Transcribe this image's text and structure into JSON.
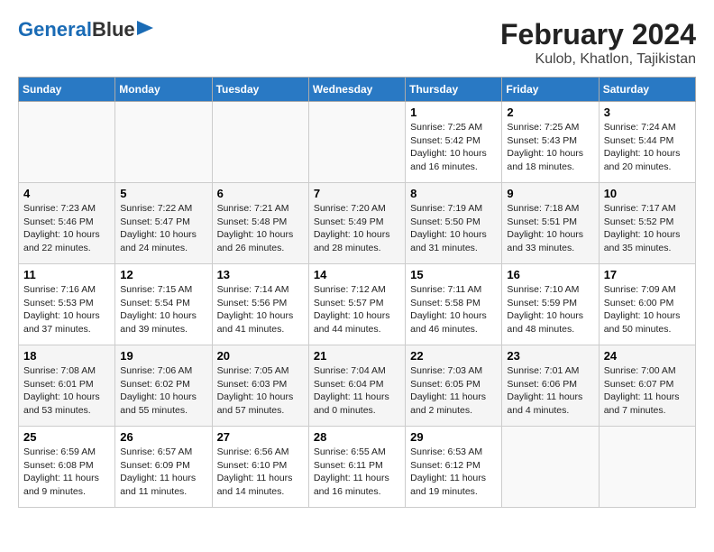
{
  "header": {
    "logo_line1": "General",
    "logo_line2": "Blue",
    "title": "February 2024",
    "subtitle": "Kulob, Khatlon, Tajikistan"
  },
  "weekdays": [
    "Sunday",
    "Monday",
    "Tuesday",
    "Wednesday",
    "Thursday",
    "Friday",
    "Saturday"
  ],
  "weeks": [
    [
      {
        "day": "",
        "detail": ""
      },
      {
        "day": "",
        "detail": ""
      },
      {
        "day": "",
        "detail": ""
      },
      {
        "day": "",
        "detail": ""
      },
      {
        "day": "1",
        "detail": "Sunrise: 7:25 AM\nSunset: 5:42 PM\nDaylight: 10 hours\nand 16 minutes."
      },
      {
        "day": "2",
        "detail": "Sunrise: 7:25 AM\nSunset: 5:43 PM\nDaylight: 10 hours\nand 18 minutes."
      },
      {
        "day": "3",
        "detail": "Sunrise: 7:24 AM\nSunset: 5:44 PM\nDaylight: 10 hours\nand 20 minutes."
      }
    ],
    [
      {
        "day": "4",
        "detail": "Sunrise: 7:23 AM\nSunset: 5:46 PM\nDaylight: 10 hours\nand 22 minutes."
      },
      {
        "day": "5",
        "detail": "Sunrise: 7:22 AM\nSunset: 5:47 PM\nDaylight: 10 hours\nand 24 minutes."
      },
      {
        "day": "6",
        "detail": "Sunrise: 7:21 AM\nSunset: 5:48 PM\nDaylight: 10 hours\nand 26 minutes."
      },
      {
        "day": "7",
        "detail": "Sunrise: 7:20 AM\nSunset: 5:49 PM\nDaylight: 10 hours\nand 28 minutes."
      },
      {
        "day": "8",
        "detail": "Sunrise: 7:19 AM\nSunset: 5:50 PM\nDaylight: 10 hours\nand 31 minutes."
      },
      {
        "day": "9",
        "detail": "Sunrise: 7:18 AM\nSunset: 5:51 PM\nDaylight: 10 hours\nand 33 minutes."
      },
      {
        "day": "10",
        "detail": "Sunrise: 7:17 AM\nSunset: 5:52 PM\nDaylight: 10 hours\nand 35 minutes."
      }
    ],
    [
      {
        "day": "11",
        "detail": "Sunrise: 7:16 AM\nSunset: 5:53 PM\nDaylight: 10 hours\nand 37 minutes."
      },
      {
        "day": "12",
        "detail": "Sunrise: 7:15 AM\nSunset: 5:54 PM\nDaylight: 10 hours\nand 39 minutes."
      },
      {
        "day": "13",
        "detail": "Sunrise: 7:14 AM\nSunset: 5:56 PM\nDaylight: 10 hours\nand 41 minutes."
      },
      {
        "day": "14",
        "detail": "Sunrise: 7:12 AM\nSunset: 5:57 PM\nDaylight: 10 hours\nand 44 minutes."
      },
      {
        "day": "15",
        "detail": "Sunrise: 7:11 AM\nSunset: 5:58 PM\nDaylight: 10 hours\nand 46 minutes."
      },
      {
        "day": "16",
        "detail": "Sunrise: 7:10 AM\nSunset: 5:59 PM\nDaylight: 10 hours\nand 48 minutes."
      },
      {
        "day": "17",
        "detail": "Sunrise: 7:09 AM\nSunset: 6:00 PM\nDaylight: 10 hours\nand 50 minutes."
      }
    ],
    [
      {
        "day": "18",
        "detail": "Sunrise: 7:08 AM\nSunset: 6:01 PM\nDaylight: 10 hours\nand 53 minutes."
      },
      {
        "day": "19",
        "detail": "Sunrise: 7:06 AM\nSunset: 6:02 PM\nDaylight: 10 hours\nand 55 minutes."
      },
      {
        "day": "20",
        "detail": "Sunrise: 7:05 AM\nSunset: 6:03 PM\nDaylight: 10 hours\nand 57 minutes."
      },
      {
        "day": "21",
        "detail": "Sunrise: 7:04 AM\nSunset: 6:04 PM\nDaylight: 11 hours\nand 0 minutes."
      },
      {
        "day": "22",
        "detail": "Sunrise: 7:03 AM\nSunset: 6:05 PM\nDaylight: 11 hours\nand 2 minutes."
      },
      {
        "day": "23",
        "detail": "Sunrise: 7:01 AM\nSunset: 6:06 PM\nDaylight: 11 hours\nand 4 minutes."
      },
      {
        "day": "24",
        "detail": "Sunrise: 7:00 AM\nSunset: 6:07 PM\nDaylight: 11 hours\nand 7 minutes."
      }
    ],
    [
      {
        "day": "25",
        "detail": "Sunrise: 6:59 AM\nSunset: 6:08 PM\nDaylight: 11 hours\nand 9 minutes."
      },
      {
        "day": "26",
        "detail": "Sunrise: 6:57 AM\nSunset: 6:09 PM\nDaylight: 11 hours\nand 11 minutes."
      },
      {
        "day": "27",
        "detail": "Sunrise: 6:56 AM\nSunset: 6:10 PM\nDaylight: 11 hours\nand 14 minutes."
      },
      {
        "day": "28",
        "detail": "Sunrise: 6:55 AM\nSunset: 6:11 PM\nDaylight: 11 hours\nand 16 minutes."
      },
      {
        "day": "29",
        "detail": "Sunrise: 6:53 AM\nSunset: 6:12 PM\nDaylight: 11 hours\nand 19 minutes."
      },
      {
        "day": "",
        "detail": ""
      },
      {
        "day": "",
        "detail": ""
      }
    ]
  ]
}
